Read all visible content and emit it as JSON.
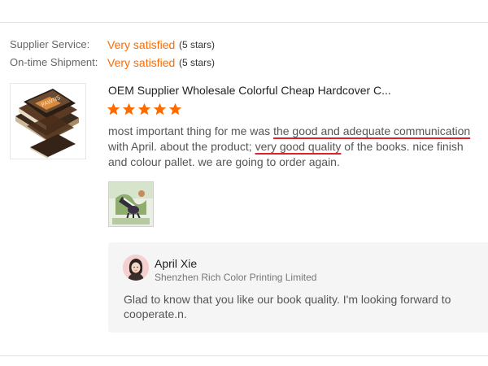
{
  "ratings": [
    {
      "label": "Supplier Service:",
      "value": "Very satisfied",
      "note": "(5 stars)"
    },
    {
      "label": "On-time Shipment:",
      "value": "Very satisfied",
      "note": "(5 stars)"
    }
  ],
  "product": {
    "title": "OEM Supplier Wholesale Colorful Cheap Hardcover C...",
    "rating": 5,
    "star_color": "#ff6a00",
    "thumbnail_icon": "hardcover-books-image"
  },
  "review": {
    "part1": "most important thing for me was ",
    "highlight1": "the good and adequate communication",
    "part2": " with April. about the product; ",
    "highlight2": "very good quality",
    "part3": " of the books. nice finish and colour pallet. we are going to order again.",
    "underline_color": "#d9242f",
    "photo_icon": "review-photo-image"
  },
  "reply": {
    "name": "April Xie",
    "company": "Shenzhen Rich Color Printing Limited",
    "text": "Glad to know that you like our book quality. I'm looking forward to cooperate.n.",
    "avatar_icon": "avatar-icon"
  },
  "colors": {
    "accent": "#ff6a00"
  }
}
